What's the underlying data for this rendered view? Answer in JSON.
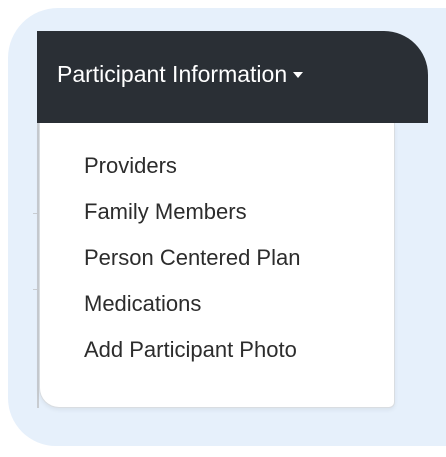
{
  "nav": {
    "toggle_label": "Participant Information",
    "caret_icon": "caret-down-icon",
    "colors": {
      "bar": "#2a2f35",
      "text": "#ffffff",
      "panel_bg": "#e6f0fb"
    }
  },
  "dropdown": {
    "items": [
      {
        "label": "Providers"
      },
      {
        "label": "Family Members"
      },
      {
        "label": "Person Centered Plan"
      },
      {
        "label": "Medications"
      },
      {
        "label": "Add Participant Photo"
      }
    ]
  }
}
